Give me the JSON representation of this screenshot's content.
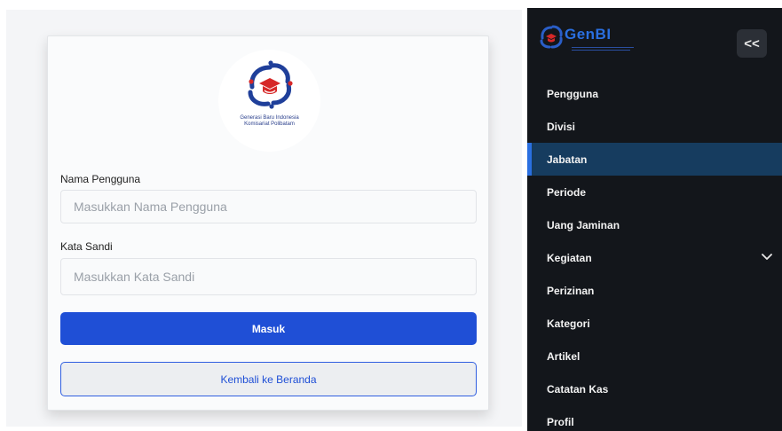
{
  "login": {
    "logo_line1": "Generasi Baru Indonesia",
    "logo_line2": "Komisariat Polibatam",
    "username_label": "Nama Pengguna",
    "username_placeholder": "Masukkan Nama Pengguna",
    "username_value": "",
    "password_label": "Kata Sandi",
    "password_placeholder": "Masukkan Kata Sandi",
    "password_value": "",
    "submit_label": "Masuk",
    "back_label": "Kembali ke Beranda"
  },
  "sidebar": {
    "brand": "GenBI",
    "collapse_icon": "chevrons-left-icon",
    "collapse_label": "<<",
    "active_item": "Jabatan",
    "items": [
      {
        "label": "Pengguna"
      },
      {
        "label": "Divisi"
      },
      {
        "label": "Jabatan",
        "active": true
      },
      {
        "label": "Periode"
      },
      {
        "label": "Uang Jaminan"
      },
      {
        "label": "Kegiatan",
        "has_submenu": true,
        "icon": "chevron-down-icon"
      },
      {
        "label": "Perizinan"
      },
      {
        "label": "Kategori"
      },
      {
        "label": "Artikel"
      },
      {
        "label": "Catatan Kas"
      },
      {
        "label": "Profil"
      }
    ]
  },
  "colors": {
    "primary": "#1f4fd6",
    "sidebar_bg": "#13161b",
    "sidebar_active": "#163c5f",
    "brand_blue": "#2a6fe0",
    "logo_red": "#d62828"
  }
}
